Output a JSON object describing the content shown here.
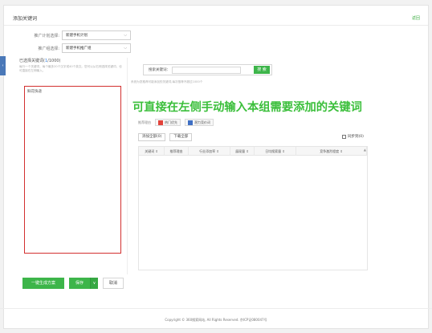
{
  "header": {
    "title": "添加关键词",
    "back_link": "返回"
  },
  "form": {
    "plan_label": "推广计划选择:",
    "plan_value": "新建手机计划",
    "unit_label": "推广组选择:",
    "unit_value": "新建手机推广组"
  },
  "left_panel": {
    "heading_prefix": "已选择关键词(",
    "heading_count": "1",
    "heading_suffix": "/1000)",
    "hint": "每行一个关键词，每个最多20个汉字或40个英文。您可以从右侧选择关键词，也可直接在左侧输入。",
    "placeholder": "鲜花快递"
  },
  "search": {
    "label": "搜索关键词：",
    "button": "搜 索",
    "hint": "系统为您推荐可能添加的关键词,每次推荐不超过1000个"
  },
  "annotation": "可直接在左侧手动输入本组需要添加的关键词",
  "tools": {
    "label": "推荐理由",
    "buttons": [
      "热门优先",
      "潜力竞价词"
    ]
  },
  "table_actions": {
    "add_all": "添加全部(0)",
    "download_all": "下载全部",
    "clear": "同步到(0)"
  },
  "table": {
    "columns": [
      {
        "label": "关键词 ⇕",
        "w": 32
      },
      {
        "label": "推荐理由",
        "w": 30
      },
      {
        "label": "行业添加率 ⇕",
        "w": 52
      },
      {
        "label": "展现量 ⇕",
        "w": 30
      },
      {
        "label": "日均搜索量 ⇕",
        "w": 52
      },
      {
        "label": "竞争激烈程度 ⇕",
        "w": 88
      }
    ]
  },
  "footer_actions": {
    "generate": "一键生成方案",
    "save": "保存",
    "caret": "∨",
    "cancel": "取消"
  },
  "footer": {
    "text": "Copyright © 360搜索网站, All Rights Reserved. 京ICP证080047号"
  },
  "colors": {
    "accent_green": "#3db54a",
    "annotation_green": "#3bbf3b",
    "highlight_red": "#d3302f"
  }
}
